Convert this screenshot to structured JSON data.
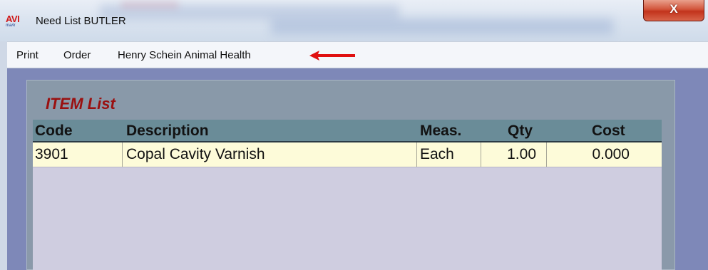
{
  "window": {
    "title": "Need List BUTLER",
    "logo_text": "AVI",
    "logo_subtext": "mark",
    "close_glyph": "X",
    "close_color": "#c2331c"
  },
  "menu": {
    "items": [
      "Print",
      "Order",
      "Henry Schein Animal Health"
    ],
    "arrow_icon": "left-arrow-icon",
    "arrow_color": "#e01010"
  },
  "panel": {
    "title": "ITEM List"
  },
  "grid": {
    "columns": [
      "Code",
      "Description",
      "Meas.",
      "Qty",
      "Cost"
    ],
    "rows": [
      {
        "code": "3901",
        "description": "Copal Cavity Varnish",
        "meas": "Each",
        "qty": "1.00",
        "cost": "0.000"
      }
    ]
  }
}
